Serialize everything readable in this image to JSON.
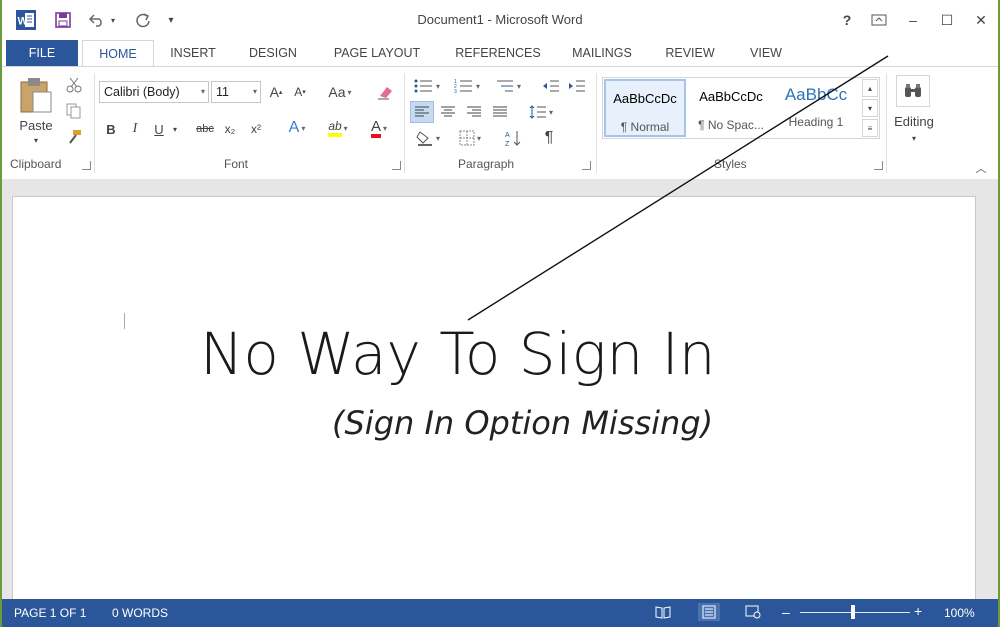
{
  "app": {
    "title": "Document1 - Microsoft Word",
    "icon": "word-app-icon"
  },
  "quick_access": {
    "save": "save-icon",
    "undo": "undo-icon",
    "redo": "redo-icon",
    "customize": "customize-icon"
  },
  "window_controls": {
    "help": "?",
    "restore_ribbon": "ribbon-display-icon",
    "minimize": "–",
    "maximize": "☐",
    "close": "✕"
  },
  "tabs": {
    "file": "FILE",
    "items": [
      "HOME",
      "INSERT",
      "DESIGN",
      "PAGE LAYOUT",
      "REFERENCES",
      "MAILINGS",
      "REVIEW",
      "VIEW"
    ]
  },
  "ribbon": {
    "clipboard": {
      "label": "Clipboard",
      "paste": "Paste"
    },
    "font": {
      "label": "Font",
      "family": "Calibri (Body)",
      "size": "11",
      "bold": "B",
      "italic": "I",
      "underline": "U",
      "strike": "abc",
      "subscript": "x₂",
      "superscript": "x²",
      "grow": "A",
      "shrink": "A",
      "case": "Aa",
      "effects": "A",
      "highlight": "ab",
      "color": "A"
    },
    "paragraph": {
      "label": "Paragraph",
      "pilcrow": "¶"
    },
    "styles": {
      "label": "Styles",
      "items": [
        {
          "sample": "AaBbCcDc",
          "name": "¶ Normal"
        },
        {
          "sample": "AaBbCcDc",
          "name": "¶ No Spac..."
        },
        {
          "sample": "AaBbCc",
          "name": "Heading 1"
        }
      ]
    },
    "editing": {
      "label": "Editing"
    }
  },
  "document": {
    "title": "No Way To Sign In",
    "subtitle": "(Sign In Option Missing)"
  },
  "status_bar": {
    "page": "PAGE 1 OF 1",
    "words": "0 WORDS",
    "zoom": "100%",
    "zoom_level": 100,
    "zoom_minus": "–",
    "zoom_plus": "+"
  },
  "colors": {
    "accent": "#2b579a",
    "highlight": "#ffff00",
    "font_red": "#e81123",
    "heading_blue": "#2e74b5"
  }
}
